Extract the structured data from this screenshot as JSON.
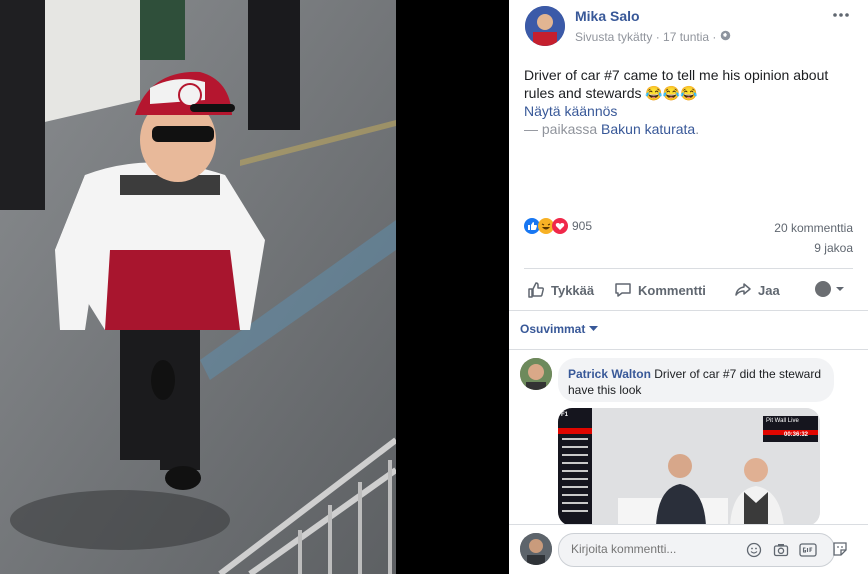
{
  "post": {
    "author": "Mika Salo",
    "meta": "Sivusta tykätty · 17 tuntia ·",
    "more_icon": "more-horizontal-icon",
    "text": "Driver of car #7 came to tell me his opinion about rules and stewards",
    "emojis": "😂😂😂",
    "translate_link": "Näytä käännös",
    "location_prefix": "— paikassa",
    "location": "Bakun katurata",
    "location_suffix": "."
  },
  "stats": {
    "reactions_count": "905",
    "comments": "20 kommenttia",
    "shares": "9 jakoa"
  },
  "actions": {
    "like": "Tykkää",
    "comment": "Kommentti",
    "share": "Jaa"
  },
  "comments": {
    "sort_label": "Osuvimmat",
    "items": [
      {
        "author": "Patrick Walton",
        "text": "Driver of car #7 did the steward have this look"
      }
    ],
    "embedded_overlay": {
      "brand": "F1",
      "live": "Pit Wall Live",
      "timer": "00:36:32"
    }
  },
  "composer": {
    "placeholder": "Kirjoita kommentti..."
  },
  "colors": {
    "link": "#385898",
    "muted": "#90949c",
    "like_blue": "#1877f2",
    "heart_red": "#f0284a"
  }
}
